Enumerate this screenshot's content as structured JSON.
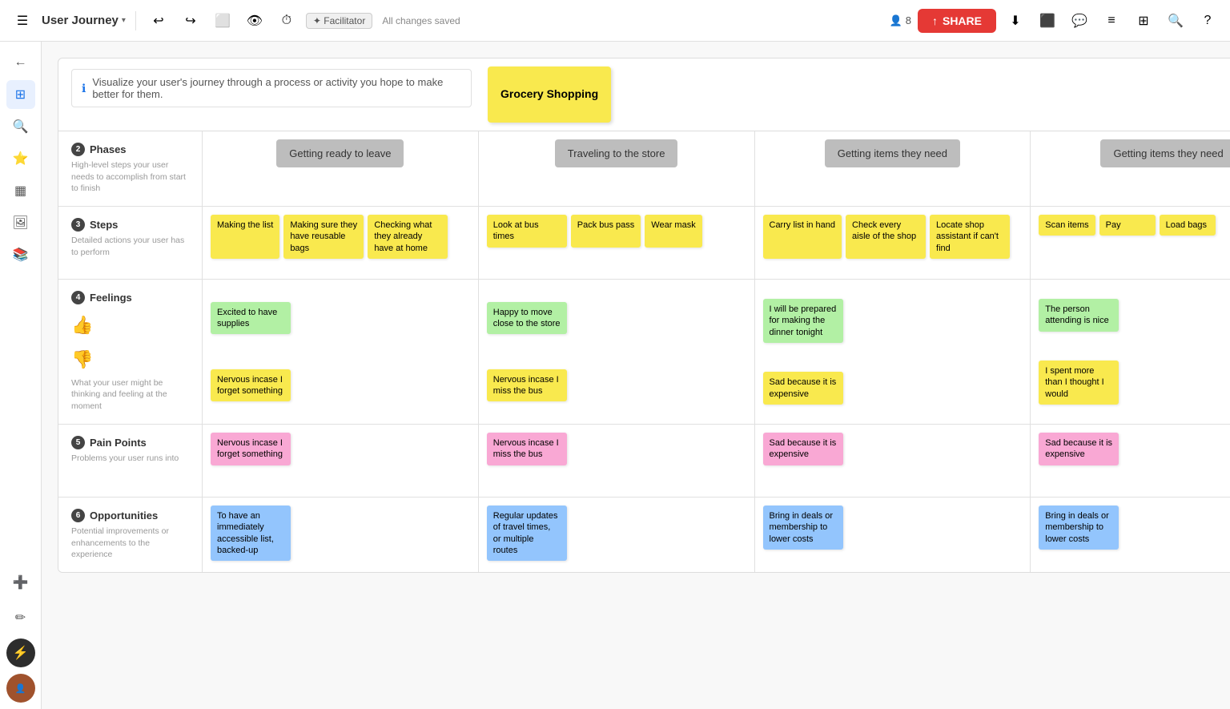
{
  "navbar": {
    "title": "User Journey",
    "facilitator_label": "✦ Facilitator",
    "saved_text": "All changes saved",
    "users_count": "8",
    "share_label": "SHARE",
    "undo_icon": "↩",
    "redo_icon": "↪"
  },
  "info_banner": {
    "text": "Visualize your user's journey through a process or activity you hope to make better for them."
  },
  "journey": {
    "title": "Grocery Shopping",
    "phases": [
      {
        "label": "Getting ready to leave"
      },
      {
        "label": "Traveling to the store"
      },
      {
        "label": "Getting items they need"
      },
      {
        "label": "Getting items they need"
      }
    ],
    "steps": [
      {
        "notes": [
          "Making the list",
          "Making sure they have reusable bags",
          "Checking what they already have at home"
        ]
      },
      {
        "notes": [
          "Look at bus times",
          "Pack bus pass",
          "Wear mask"
        ]
      },
      {
        "notes": [
          "Carry list in hand",
          "Check every aisle of the shop",
          "Locate shop assistant if can't find"
        ]
      },
      {
        "notes": [
          "Scan items",
          "Pay",
          "Load bags"
        ]
      }
    ],
    "feelings_positive": [
      {
        "note": "Excited to have supplies"
      },
      {
        "note": "Happy to move close to the store"
      },
      {
        "note": "I will be prepared for making the dinner tonight"
      },
      {
        "note": "The person attending is nice"
      }
    ],
    "feelings_negative": [
      {
        "note": "Nervous incase I forget something"
      },
      {
        "note": "Nervous incase I miss the bus"
      },
      {
        "note": "Sad because it is expensive"
      },
      {
        "note": "I spent more than I thought I would"
      }
    ],
    "pain_points": [
      {
        "note": "Nervous incase I forget something"
      },
      {
        "note": "Nervous incase I miss the bus"
      },
      {
        "note": "Sad because it is expensive"
      },
      {
        "note": "Sad because it is expensive"
      }
    ],
    "opportunities": [
      {
        "note": "To have an immediately accessible list, backed-up"
      },
      {
        "note": "Regular updates of travel times, or multiple routes"
      },
      {
        "note": "Bring in deals or membership to lower costs"
      },
      {
        "note": "Bring in deals or membership to lower costs"
      }
    ]
  },
  "sidebar": {
    "icons": [
      "☰",
      "🔍",
      "⭐",
      "⊞",
      "🖼",
      "📚",
      "➕",
      "✏"
    ]
  }
}
